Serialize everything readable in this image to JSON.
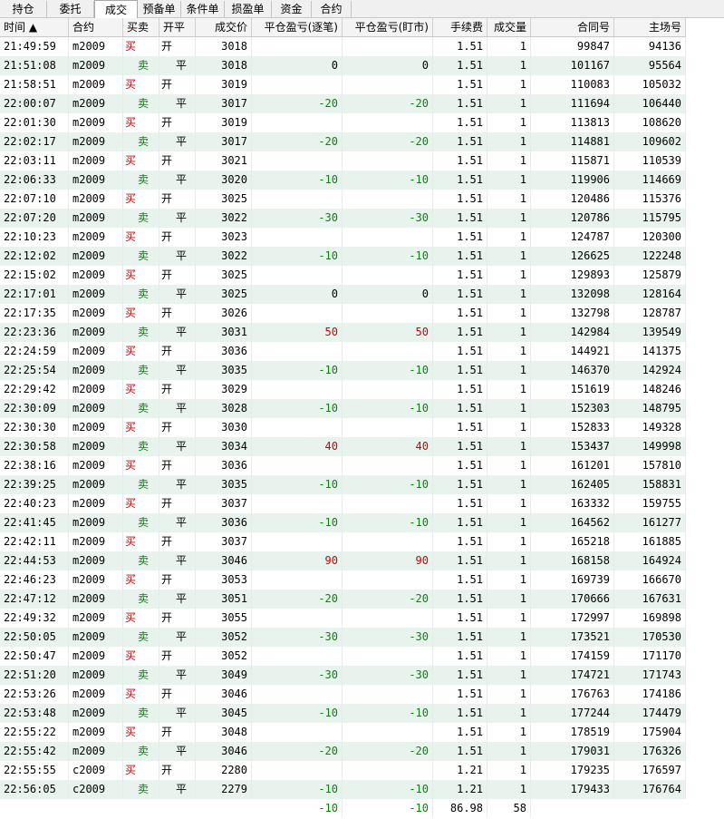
{
  "tabs": [
    "持仓",
    "委托",
    "成交",
    "预备单",
    "条件单",
    "损盈单",
    "资金",
    "合约"
  ],
  "active_tab": "成交",
  "columns": [
    "时间 ▲",
    "合约",
    "买卖",
    "开平",
    "成交价",
    "平仓盈亏(逐笔)",
    "平仓盈亏(盯市)",
    "手续费",
    "成交量",
    "合同号",
    "主场号"
  ],
  "rows": [
    {
      "time": "21:49:59",
      "contract": "m2009",
      "side": "买",
      "oc": "开",
      "price": "3018",
      "pnl1": "",
      "pnl2": "",
      "fee": "1.51",
      "qty": "1",
      "order": "99847",
      "deal": "94136"
    },
    {
      "time": "21:51:08",
      "contract": "m2009",
      "side": "卖",
      "oc": "平",
      "price": "3018",
      "pnl1": "0",
      "pnl2": "0",
      "fee": "1.51",
      "qty": "1",
      "order": "101167",
      "deal": "95564"
    },
    {
      "time": "21:58:51",
      "contract": "m2009",
      "side": "买",
      "oc": "开",
      "price": "3019",
      "pnl1": "",
      "pnl2": "",
      "fee": "1.51",
      "qty": "1",
      "order": "110083",
      "deal": "105032"
    },
    {
      "time": "22:00:07",
      "contract": "m2009",
      "side": "卖",
      "oc": "平",
      "price": "3017",
      "pnl1": "-20",
      "pnl2": "-20",
      "fee": "1.51",
      "qty": "1",
      "order": "111694",
      "deal": "106440"
    },
    {
      "time": "22:01:30",
      "contract": "m2009",
      "side": "买",
      "oc": "开",
      "price": "3019",
      "pnl1": "",
      "pnl2": "",
      "fee": "1.51",
      "qty": "1",
      "order": "113813",
      "deal": "108620"
    },
    {
      "time": "22:02:17",
      "contract": "m2009",
      "side": "卖",
      "oc": "平",
      "price": "3017",
      "pnl1": "-20",
      "pnl2": "-20",
      "fee": "1.51",
      "qty": "1",
      "order": "114881",
      "deal": "109602"
    },
    {
      "time": "22:03:11",
      "contract": "m2009",
      "side": "买",
      "oc": "开",
      "price": "3021",
      "pnl1": "",
      "pnl2": "",
      "fee": "1.51",
      "qty": "1",
      "order": "115871",
      "deal": "110539"
    },
    {
      "time": "22:06:33",
      "contract": "m2009",
      "side": "卖",
      "oc": "平",
      "price": "3020",
      "pnl1": "-10",
      "pnl2": "-10",
      "fee": "1.51",
      "qty": "1",
      "order": "119906",
      "deal": "114669"
    },
    {
      "time": "22:07:10",
      "contract": "m2009",
      "side": "买",
      "oc": "开",
      "price": "3025",
      "pnl1": "",
      "pnl2": "",
      "fee": "1.51",
      "qty": "1",
      "order": "120486",
      "deal": "115376"
    },
    {
      "time": "22:07:20",
      "contract": "m2009",
      "side": "卖",
      "oc": "平",
      "price": "3022",
      "pnl1": "-30",
      "pnl2": "-30",
      "fee": "1.51",
      "qty": "1",
      "order": "120786",
      "deal": "115795"
    },
    {
      "time": "22:10:23",
      "contract": "m2009",
      "side": "买",
      "oc": "开",
      "price": "3023",
      "pnl1": "",
      "pnl2": "",
      "fee": "1.51",
      "qty": "1",
      "order": "124787",
      "deal": "120300"
    },
    {
      "time": "22:12:02",
      "contract": "m2009",
      "side": "卖",
      "oc": "平",
      "price": "3022",
      "pnl1": "-10",
      "pnl2": "-10",
      "fee": "1.51",
      "qty": "1",
      "order": "126625",
      "deal": "122248"
    },
    {
      "time": "22:15:02",
      "contract": "m2009",
      "side": "买",
      "oc": "开",
      "price": "3025",
      "pnl1": "",
      "pnl2": "",
      "fee": "1.51",
      "qty": "1",
      "order": "129893",
      "deal": "125879"
    },
    {
      "time": "22:17:01",
      "contract": "m2009",
      "side": "卖",
      "oc": "平",
      "price": "3025",
      "pnl1": "0",
      "pnl2": "0",
      "fee": "1.51",
      "qty": "1",
      "order": "132098",
      "deal": "128164"
    },
    {
      "time": "22:17:35",
      "contract": "m2009",
      "side": "买",
      "oc": "开",
      "price": "3026",
      "pnl1": "",
      "pnl2": "",
      "fee": "1.51",
      "qty": "1",
      "order": "132798",
      "deal": "128787"
    },
    {
      "time": "22:23:36",
      "contract": "m2009",
      "side": "卖",
      "oc": "平",
      "price": "3031",
      "pnl1": "50",
      "pnl2": "50",
      "fee": "1.51",
      "qty": "1",
      "order": "142984",
      "deal": "139549"
    },
    {
      "time": "22:24:59",
      "contract": "m2009",
      "side": "买",
      "oc": "开",
      "price": "3036",
      "pnl1": "",
      "pnl2": "",
      "fee": "1.51",
      "qty": "1",
      "order": "144921",
      "deal": "141375"
    },
    {
      "time": "22:25:54",
      "contract": "m2009",
      "side": "卖",
      "oc": "平",
      "price": "3035",
      "pnl1": "-10",
      "pnl2": "-10",
      "fee": "1.51",
      "qty": "1",
      "order": "146370",
      "deal": "142924"
    },
    {
      "time": "22:29:42",
      "contract": "m2009",
      "side": "买",
      "oc": "开",
      "price": "3029",
      "pnl1": "",
      "pnl2": "",
      "fee": "1.51",
      "qty": "1",
      "order": "151619",
      "deal": "148246"
    },
    {
      "time": "22:30:09",
      "contract": "m2009",
      "side": "卖",
      "oc": "平",
      "price": "3028",
      "pnl1": "-10",
      "pnl2": "-10",
      "fee": "1.51",
      "qty": "1",
      "order": "152303",
      "deal": "148795"
    },
    {
      "time": "22:30:30",
      "contract": "m2009",
      "side": "买",
      "oc": "开",
      "price": "3030",
      "pnl1": "",
      "pnl2": "",
      "fee": "1.51",
      "qty": "1",
      "order": "152833",
      "deal": "149328"
    },
    {
      "time": "22:30:58",
      "contract": "m2009",
      "side": "卖",
      "oc": "平",
      "price": "3034",
      "pnl1": "40",
      "pnl2": "40",
      "fee": "1.51",
      "qty": "1",
      "order": "153437",
      "deal": "149998"
    },
    {
      "time": "22:38:16",
      "contract": "m2009",
      "side": "买",
      "oc": "开",
      "price": "3036",
      "pnl1": "",
      "pnl2": "",
      "fee": "1.51",
      "qty": "1",
      "order": "161201",
      "deal": "157810"
    },
    {
      "time": "22:39:25",
      "contract": "m2009",
      "side": "卖",
      "oc": "平",
      "price": "3035",
      "pnl1": "-10",
      "pnl2": "-10",
      "fee": "1.51",
      "qty": "1",
      "order": "162405",
      "deal": "158831"
    },
    {
      "time": "22:40:23",
      "contract": "m2009",
      "side": "买",
      "oc": "开",
      "price": "3037",
      "pnl1": "",
      "pnl2": "",
      "fee": "1.51",
      "qty": "1",
      "order": "163332",
      "deal": "159755"
    },
    {
      "time": "22:41:45",
      "contract": "m2009",
      "side": "卖",
      "oc": "平",
      "price": "3036",
      "pnl1": "-10",
      "pnl2": "-10",
      "fee": "1.51",
      "qty": "1",
      "order": "164562",
      "deal": "161277"
    },
    {
      "time": "22:42:11",
      "contract": "m2009",
      "side": "买",
      "oc": "开",
      "price": "3037",
      "pnl1": "",
      "pnl2": "",
      "fee": "1.51",
      "qty": "1",
      "order": "165218",
      "deal": "161885"
    },
    {
      "time": "22:44:53",
      "contract": "m2009",
      "side": "卖",
      "oc": "平",
      "price": "3046",
      "pnl1": "90",
      "pnl2": "90",
      "fee": "1.51",
      "qty": "1",
      "order": "168158",
      "deal": "164924"
    },
    {
      "time": "22:46:23",
      "contract": "m2009",
      "side": "买",
      "oc": "开",
      "price": "3053",
      "pnl1": "",
      "pnl2": "",
      "fee": "1.51",
      "qty": "1",
      "order": "169739",
      "deal": "166670"
    },
    {
      "time": "22:47:12",
      "contract": "m2009",
      "side": "卖",
      "oc": "平",
      "price": "3051",
      "pnl1": "-20",
      "pnl2": "-20",
      "fee": "1.51",
      "qty": "1",
      "order": "170666",
      "deal": "167631"
    },
    {
      "time": "22:49:32",
      "contract": "m2009",
      "side": "买",
      "oc": "开",
      "price": "3055",
      "pnl1": "",
      "pnl2": "",
      "fee": "1.51",
      "qty": "1",
      "order": "172997",
      "deal": "169898"
    },
    {
      "time": "22:50:05",
      "contract": "m2009",
      "side": "卖",
      "oc": "平",
      "price": "3052",
      "pnl1": "-30",
      "pnl2": "-30",
      "fee": "1.51",
      "qty": "1",
      "order": "173521",
      "deal": "170530"
    },
    {
      "time": "22:50:47",
      "contract": "m2009",
      "side": "买",
      "oc": "开",
      "price": "3052",
      "pnl1": "",
      "pnl2": "",
      "fee": "1.51",
      "qty": "1",
      "order": "174159",
      "deal": "171170"
    },
    {
      "time": "22:51:20",
      "contract": "m2009",
      "side": "卖",
      "oc": "平",
      "price": "3049",
      "pnl1": "-30",
      "pnl2": "-30",
      "fee": "1.51",
      "qty": "1",
      "order": "174721",
      "deal": "171743"
    },
    {
      "time": "22:53:26",
      "contract": "m2009",
      "side": "买",
      "oc": "开",
      "price": "3046",
      "pnl1": "",
      "pnl2": "",
      "fee": "1.51",
      "qty": "1",
      "order": "176763",
      "deal": "174186"
    },
    {
      "time": "22:53:48",
      "contract": "m2009",
      "side": "卖",
      "oc": "平",
      "price": "3045",
      "pnl1": "-10",
      "pnl2": "-10",
      "fee": "1.51",
      "qty": "1",
      "order": "177244",
      "deal": "174479"
    },
    {
      "time": "22:55:22",
      "contract": "m2009",
      "side": "买",
      "oc": "开",
      "price": "3048",
      "pnl1": "",
      "pnl2": "",
      "fee": "1.51",
      "qty": "1",
      "order": "178519",
      "deal": "175904"
    },
    {
      "time": "22:55:42",
      "contract": "m2009",
      "side": "卖",
      "oc": "平",
      "price": "3046",
      "pnl1": "-20",
      "pnl2": "-20",
      "fee": "1.51",
      "qty": "1",
      "order": "179031",
      "deal": "176326"
    },
    {
      "time": "22:55:55",
      "contract": "c2009",
      "side": "买",
      "oc": "开",
      "price": "2280",
      "pnl1": "",
      "pnl2": "",
      "fee": "1.21",
      "qty": "1",
      "order": "179235",
      "deal": "176597"
    },
    {
      "time": "22:56:05",
      "contract": "c2009",
      "side": "卖",
      "oc": "平",
      "price": "2279",
      "pnl1": "-10",
      "pnl2": "-10",
      "fee": "1.21",
      "qty": "1",
      "order": "179433",
      "deal": "176764"
    }
  ],
  "totals": {
    "pnl1": "-10",
    "pnl2": "-10",
    "fee": "86.98",
    "qty": "58"
  },
  "colors": {
    "buy": "#d40000",
    "sell": "#008a00",
    "loss": "#008a00",
    "profit": "#d40000",
    "stripe": "#e9f3ee"
  }
}
